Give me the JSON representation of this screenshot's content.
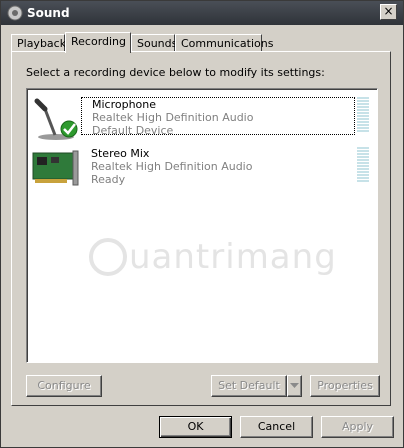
{
  "window": {
    "title": "Sound",
    "close_label": "×"
  },
  "tabs": [
    {
      "label": "Playback",
      "active": false
    },
    {
      "label": "Recording",
      "active": true
    },
    {
      "label": "Sounds",
      "active": false
    },
    {
      "label": "Communications",
      "active": false
    }
  ],
  "recording": {
    "instruction": "Select a recording device below to modify its settings:",
    "devices": [
      {
        "name": "Microphone",
        "driver": "Realtek High Definition Audio",
        "status": "Default Device",
        "icon": "microphone-icon",
        "selected": true
      },
      {
        "name": "Stereo Mix",
        "driver": "Realtek High Definition Audio",
        "status": "Ready",
        "icon": "sound-card-icon",
        "selected": false
      }
    ],
    "configure_label": "Configure",
    "set_default_label": "Set Default",
    "properties_label": "Properties"
  },
  "watermark": {
    "text": "uantrimang"
  },
  "dialog": {
    "ok_label": "OK",
    "cancel_label": "Cancel",
    "apply_label": "Apply"
  },
  "colors": {
    "titlebar": "#2f3339",
    "dialog_bg": "#d4d0c8",
    "check_green": "#2e9a2e",
    "meter": "#c7e2e8"
  }
}
